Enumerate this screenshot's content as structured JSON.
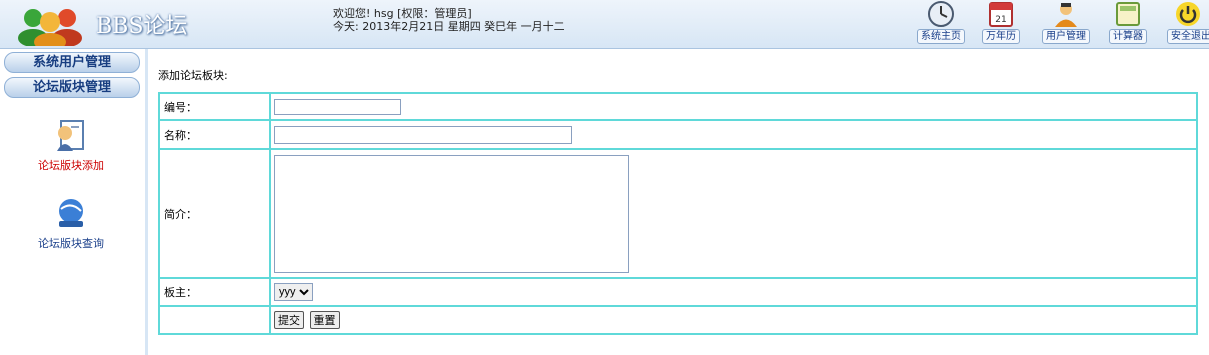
{
  "header": {
    "site_title": "BBS论坛",
    "welcome_line": "欢迎您! hsg [权限：管理员]",
    "date_line": "今天:  2013年2月21日 星期四 癸巳年 一月十二"
  },
  "toolbar": [
    {
      "label": "系统主页",
      "icon": "clock-icon"
    },
    {
      "label": "万年历",
      "icon": "calendar-icon"
    },
    {
      "label": "用户管理",
      "icon": "user-icon"
    },
    {
      "label": "计算器",
      "icon": "calculator-icon"
    },
    {
      "label": "安全退出",
      "icon": "power-icon"
    }
  ],
  "sidebar": {
    "headers": [
      "系统用户管理",
      "论坛版块管理"
    ],
    "items": [
      {
        "label": "论坛版块添加",
        "icon": "document-add-icon",
        "active": true
      },
      {
        "label": "论坛版块查询",
        "icon": "globe-search-icon",
        "active": false
      }
    ]
  },
  "main": {
    "form_title": "添加论坛板块:",
    "fields": {
      "id_label": "编号：",
      "id_value": "",
      "name_label": "名称：",
      "name_value": "",
      "intro_label": "简介：",
      "intro_value": "",
      "moderator_label": "板主：",
      "moderator_value": "yyy"
    },
    "submit_label": "提交",
    "reset_label": "重置"
  },
  "colors": {
    "table_border": "#5fd9d9",
    "active_nav": "#cc0000",
    "nav_text": "#1a3f8a"
  }
}
